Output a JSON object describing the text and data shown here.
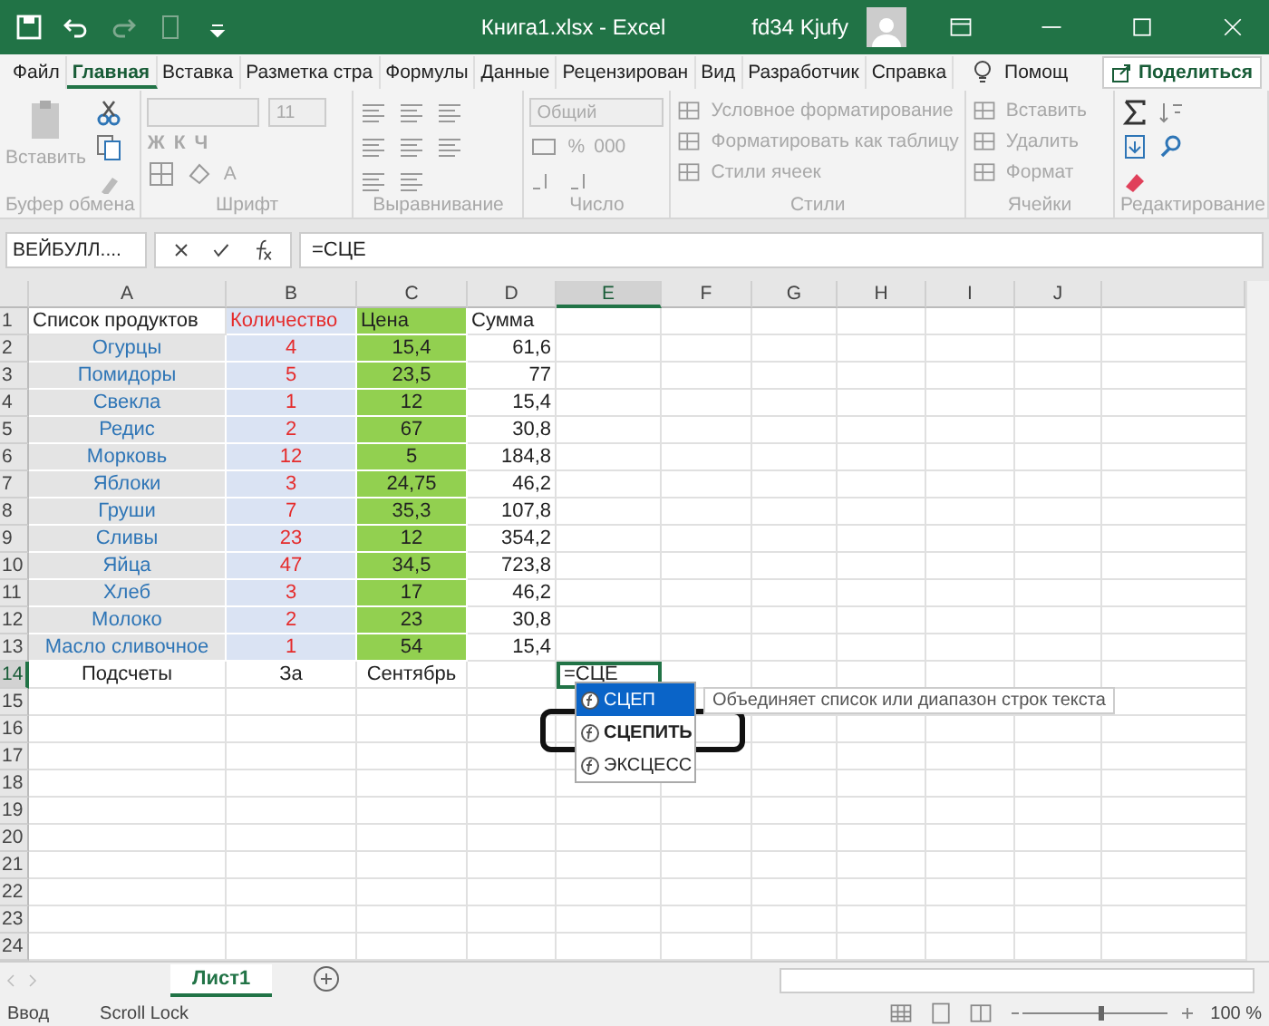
{
  "title_bar": {
    "title": "Книга1.xlsx  -  Excel",
    "user": "fd34 Kjufy"
  },
  "ribbon_tabs": [
    {
      "label": "Файл",
      "selected": false
    },
    {
      "label": "Главная",
      "selected": true
    },
    {
      "label": "Вставка",
      "selected": false
    },
    {
      "label": "Разметка стра",
      "selected": false
    },
    {
      "label": "Формулы",
      "selected": false
    },
    {
      "label": "Данные",
      "selected": false
    },
    {
      "label": "Рецензирован",
      "selected": false
    },
    {
      "label": "Вид",
      "selected": false
    },
    {
      "label": "Разработчик",
      "selected": false
    },
    {
      "label": "Справка",
      "selected": false
    }
  ],
  "tell_me": "Помощ",
  "share": "Поделиться",
  "ribbon": {
    "disabled": true,
    "groups": [
      {
        "kind": "clipboard",
        "label": "Буфер обмена",
        "items": [
          "Вставить"
        ]
      },
      {
        "kind": "font",
        "label": "Шрифт",
        "items": [
          "11",
          "Ж",
          "К",
          "Ч",
          "A"
        ]
      },
      {
        "kind": "alignment",
        "label": "Выравнивание"
      },
      {
        "kind": "number",
        "label": "Число",
        "items": [
          "Общий",
          "%",
          "000"
        ]
      },
      {
        "kind": "styles",
        "label": "Стили",
        "items": [
          "Условное форматирование",
          "Форматировать как таблицу",
          "Стили ячеек"
        ]
      },
      {
        "kind": "cells",
        "label": "Ячейки",
        "items": [
          "Вставить",
          "Удалить",
          "Формат"
        ]
      },
      {
        "kind": "editing",
        "label": "Редактирование"
      }
    ]
  },
  "formula_bar": {
    "name_box": "ВЕЙБУЛЛ....",
    "formula": "=СЦЕ"
  },
  "columns": [
    {
      "label": "A",
      "selected": false
    },
    {
      "label": "B",
      "selected": false
    },
    {
      "label": "C",
      "selected": false
    },
    {
      "label": "D",
      "selected": false
    },
    {
      "label": "E",
      "selected": true
    },
    {
      "label": "F",
      "selected": false
    },
    {
      "label": "G",
      "selected": false
    },
    {
      "label": "H",
      "selected": false
    },
    {
      "label": "I",
      "selected": false
    },
    {
      "label": "J",
      "selected": false
    }
  ],
  "rows": [
    {
      "number": "1",
      "kind": "header",
      "selected": false,
      "cells": [
        "Список продуктов",
        "Количество",
        "Цена",
        "Сумма"
      ]
    },
    {
      "number": "2",
      "kind": "item",
      "selected": false,
      "cells": [
        "Огурцы",
        "4",
        "15,4",
        "61,6"
      ]
    },
    {
      "number": "3",
      "kind": "item",
      "selected": false,
      "cells": [
        "Помидоры",
        "5",
        "23,5",
        "77"
      ]
    },
    {
      "number": "4",
      "kind": "item",
      "selected": false,
      "cells": [
        "Свекла",
        "1",
        "12",
        "15,4"
      ]
    },
    {
      "number": "5",
      "kind": "item",
      "selected": false,
      "cells": [
        "Редис",
        "2",
        "67",
        "30,8"
      ]
    },
    {
      "number": "6",
      "kind": "item",
      "selected": false,
      "cells": [
        "Морковь",
        "12",
        "5",
        "184,8"
      ]
    },
    {
      "number": "7",
      "kind": "item",
      "selected": false,
      "cells": [
        "Яблоки",
        "3",
        "24,75",
        "46,2"
      ]
    },
    {
      "number": "8",
      "kind": "item",
      "selected": false,
      "cells": [
        "Груши",
        "7",
        "35,3",
        "107,8"
      ]
    },
    {
      "number": "9",
      "kind": "item",
      "selected": false,
      "cells": [
        "Сливы",
        "23",
        "12",
        "354,2"
      ]
    },
    {
      "number": "10",
      "kind": "item",
      "selected": false,
      "cells": [
        "Яйца",
        "47",
        "34,5",
        "723,8"
      ]
    },
    {
      "number": "11",
      "kind": "item",
      "selected": false,
      "cells": [
        "Хлеб",
        "3",
        "17",
        "46,2"
      ]
    },
    {
      "number": "12",
      "kind": "item",
      "selected": false,
      "cells": [
        "Молоко",
        "2",
        "23",
        "30,8"
      ]
    },
    {
      "number": "13",
      "kind": "item",
      "selected": false,
      "cells": [
        "Масло сливочное",
        "1",
        "54",
        "15,4"
      ]
    },
    {
      "number": "14",
      "kind": "summary",
      "selected": true,
      "cells": [
        "Подсчеты",
        "За",
        "Сентябрь",
        ""
      ],
      "editing": "=СЦЕ"
    },
    {
      "number": "15",
      "selected": false
    },
    {
      "number": "16",
      "selected": false
    },
    {
      "number": "17",
      "selected": false
    },
    {
      "number": "18",
      "selected": false
    },
    {
      "number": "19",
      "selected": false
    },
    {
      "number": "20",
      "selected": false
    },
    {
      "number": "21",
      "selected": false
    },
    {
      "number": "22",
      "selected": false
    },
    {
      "number": "23",
      "selected": false
    },
    {
      "number": "24",
      "selected": false
    }
  ],
  "autocomplete": {
    "items": [
      {
        "label": "СЦЕП",
        "selected": true,
        "highlighted": false
      },
      {
        "label": "СЦЕПИТЬ",
        "selected": false,
        "highlighted": true
      },
      {
        "label": "ЭКСЦЕСС",
        "selected": false,
        "highlighted": false
      }
    ],
    "tooltip": "Объединяет список или диапазон строк текста"
  },
  "sheet_tabs": [
    {
      "label": "Лист1",
      "selected": true
    }
  ],
  "status_bar": {
    "items": [
      "Ввод",
      "Scroll Lock"
    ],
    "zoom": "100 %"
  }
}
